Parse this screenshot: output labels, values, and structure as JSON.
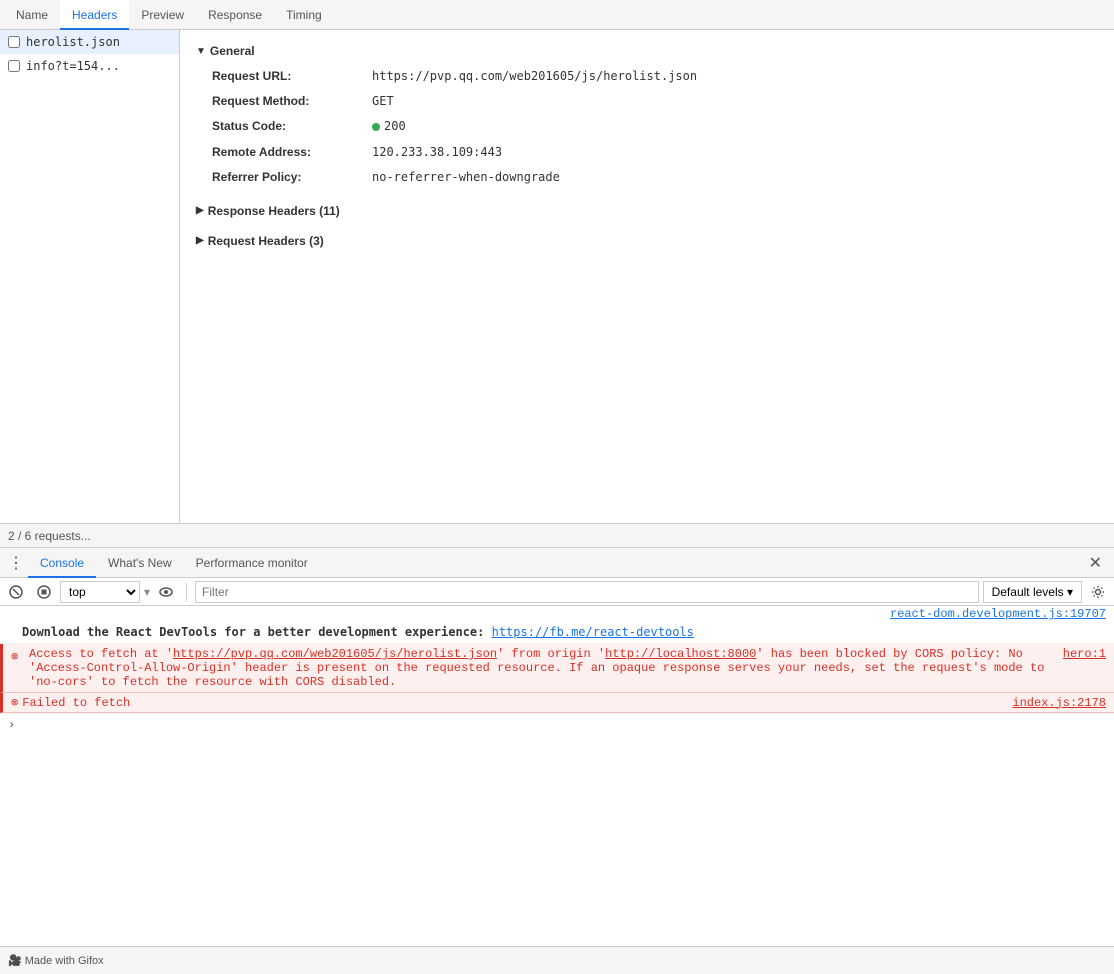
{
  "tabs": {
    "items": [
      {
        "label": "Name",
        "active": false
      },
      {
        "label": "Headers",
        "active": true
      },
      {
        "label": "Preview",
        "active": false
      },
      {
        "label": "Response",
        "active": false
      },
      {
        "label": "Timing",
        "active": false
      }
    ]
  },
  "fileList": {
    "items": [
      {
        "name": "herolist.json",
        "selected": true
      },
      {
        "name": "info?t=154...",
        "selected": false
      }
    ]
  },
  "general": {
    "title": "General",
    "requestUrl": {
      "key": "Request URL:",
      "value": "https://pvp.qq.com/web201605/js/herolist.json"
    },
    "requestMethod": {
      "key": "Request Method:",
      "value": "GET"
    },
    "statusCode": {
      "key": "Status Code:",
      "value": "200"
    },
    "remoteAddress": {
      "key": "Remote Address:",
      "value": "120.233.38.109:443"
    },
    "referrerPolicy": {
      "key": "Referrer Policy:",
      "value": "no-referrer-when-downgrade"
    }
  },
  "responseHeaders": {
    "label": "Response Headers (11)"
  },
  "requestHeaders": {
    "label": "Request Headers (3)"
  },
  "statusBar": {
    "text": "2 / 6 requests..."
  },
  "bottomTabs": {
    "items": [
      {
        "label": "Console",
        "active": true
      },
      {
        "label": "What's New",
        "active": false
      },
      {
        "label": "Performance monitor",
        "active": false
      }
    ]
  },
  "consoleToolbar": {
    "contextLabel": "top",
    "filterPlaceholder": "Filter",
    "levelsLabel": "Default levels ▾"
  },
  "consoleMessages": {
    "reactSource": "react-dom.development.js:19707",
    "reactMessage1": "Download the React DevTools for a better development experience: ",
    "reactLink": "https://fb.me/react-devtools",
    "errorSource": "hero:1",
    "errorMessage1": "Access to fetch at",
    "errorUrl1": "https://pvp.qq.com/web201605/js/herolist.json",
    "errorMessage2": "' from origin '",
    "errorUrl2": "http://localhost:8000",
    "errorMessage3": "' has been blocked by CORS policy: No 'Access-Control-Allow-Origin' header is present on the requested resource. If an opaque response serves your needs, set the request's mode to 'no-cors' to fetch the resource with CORS disabled.",
    "failedSource": "index.js:2178",
    "failedMessage": "Failed to fetch"
  }
}
